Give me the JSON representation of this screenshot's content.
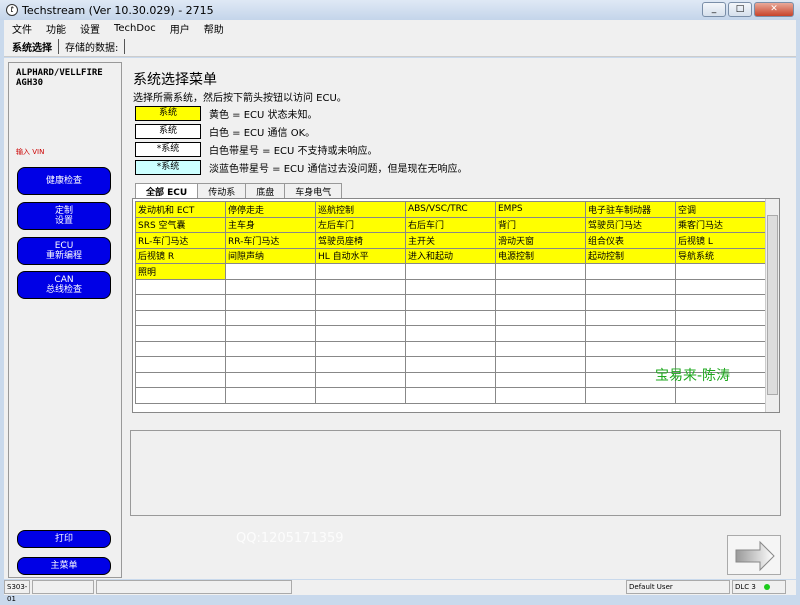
{
  "window": {
    "title": "Techstream (Ver 10.30.029) - 2715",
    "min": "_",
    "max": "□",
    "close": "✕"
  },
  "menu": [
    "文件",
    "功能",
    "设置",
    "TechDoc",
    "用户",
    "帮助"
  ],
  "toolbar": {
    "system_select": "系统选择",
    "stored_data": "存储的数据:"
  },
  "sidebar": {
    "model": "ALPHARD/VELLFIRE",
    "model_code": "AGH30",
    "vin_label": "输入 VIN",
    "buttons": [
      "健康检查",
      "定制\n设置",
      "ECU\n重新编程",
      "CAN\n总线检查"
    ],
    "print": "打印",
    "main_menu": "主菜单"
  },
  "main": {
    "title": "系统选择菜单",
    "instruction": "选择所需系统，然后按下箭头按钮以访问 ECU。",
    "legend": [
      {
        "box": "系统",
        "color": "#ffff00",
        "text": "黄色 = ECU 状态未知。"
      },
      {
        "box": "系统",
        "color": "#ffffff",
        "text": "白色 = ECU 通信 OK。"
      },
      {
        "box": "*系统",
        "color": "#ffffff",
        "text": "白色带星号 =  ECU 不支持或未响应。"
      },
      {
        "box": "*系统",
        "color": "#ccffff",
        "text": "淡蓝色带星号 = ECU 通信过去没问题，但是现在无响应。"
      }
    ],
    "tabs": [
      "全部 ECU",
      "传动系",
      "底盘",
      "车身电气"
    ],
    "systems": [
      [
        "发动机和 ECT",
        "停停走走",
        "巡航控制",
        "ABS/VSC/TRC",
        "EMPS",
        "电子驻车制动器",
        "空调"
      ],
      [
        "SRS 空气囊",
        "主车身",
        "左后车门",
        "右后车门",
        "背门",
        "驾驶员门马达",
        "乘客门马达"
      ],
      [
        "RL-车门马达",
        "RR-车门马达",
        "驾驶员座椅",
        "主开关",
        "滑动天窗",
        "组合仪表",
        "后视镜 L"
      ],
      [
        "后视镜 R",
        "间隙声纳",
        "HL 自动水平",
        "进入和起动",
        "电源控制",
        "起动控制",
        "导航系统"
      ],
      [
        "照明",
        "",
        "",
        "",
        "",
        "",
        ""
      ]
    ],
    "watermark": "宝易来-陈涛",
    "qq": "QQ:1205171359"
  },
  "status": {
    "code": "S303-01",
    "user": "Default User",
    "dlc": "DLC 3"
  }
}
